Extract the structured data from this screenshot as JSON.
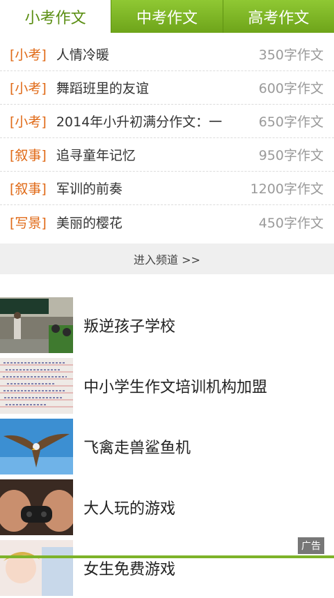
{
  "tabs": [
    {
      "label": "小考作文",
      "active": true
    },
    {
      "label": "中考作文",
      "active": false
    },
    {
      "label": "高考作文",
      "active": false
    }
  ],
  "articles": [
    {
      "category": "[小考]",
      "title": "人情冷暖",
      "count": "350字作文"
    },
    {
      "category": "[小考]",
      "title": "舞蹈班里的友谊",
      "count": "600字作文"
    },
    {
      "category": "[小考]",
      "title": "2014年小升初满分作文：一",
      "count": "650字作文"
    },
    {
      "category": "[叙事]",
      "title": "追寻童年记忆",
      "count": "950字作文"
    },
    {
      "category": "[叙事]",
      "title": "军训的前奏",
      "count": "1200字作文"
    },
    {
      "category": "[写景]",
      "title": "美丽的樱花",
      "count": "450字作文"
    }
  ],
  "more_label": "进入频道 >>",
  "ads": [
    {
      "title": "叛逆孩子学校"
    },
    {
      "title": "中小学生作文培训机构加盟"
    },
    {
      "title": "飞禽走兽鲨鱼机"
    },
    {
      "title": "大人玩的游戏"
    },
    {
      "title": "女生免费游戏"
    }
  ],
  "ad_badge": "广告",
  "colors": {
    "accent": "#7db32a",
    "category": "#e06a17"
  }
}
